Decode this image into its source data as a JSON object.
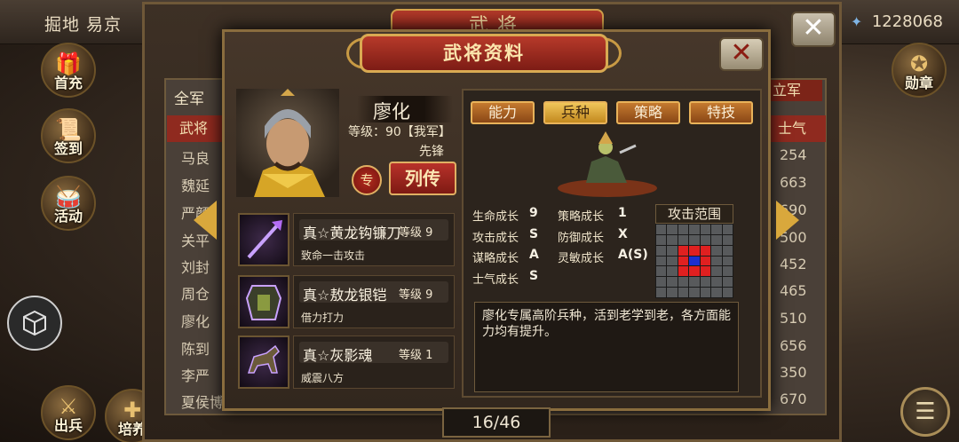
{
  "topbar": {
    "location": "掘地 易京",
    "gold": "1228068",
    "gold_icon": "sapphire-icon"
  },
  "side_buttons": [
    {
      "label": "首充",
      "icon": "gift-icon"
    },
    {
      "label": "签到",
      "icon": "scroll-icon"
    },
    {
      "label": "活动",
      "icon": "drum-icon"
    },
    {
      "label": "出兵",
      "icon": "sword-icon"
    },
    {
      "label": "培养",
      "icon": "training-icon"
    },
    {
      "label": "勋章",
      "icon": "medal-icon"
    }
  ],
  "list_window": {
    "title": "武将",
    "header_left": "全军",
    "header_right": "立军",
    "col_general": "武将",
    "col_morale": "士气",
    "generals": [
      "马良",
      "魏延",
      "严颜",
      "关平",
      "刘封",
      "周仓",
      "廖化",
      "陈到",
      "李严",
      "夏侯博"
    ],
    "morale": [
      "254",
      "663",
      "690",
      "500",
      "452",
      "465",
      "510",
      "656",
      "350",
      "670"
    ],
    "page": "16/46"
  },
  "dialog": {
    "title": "武将资料",
    "name": "廖化",
    "level_text": "等级：90【我军】",
    "role": "先锋",
    "special_badge": "专",
    "bio_button": "列传",
    "equipment": [
      {
        "name": "真☆黄龙钩镰刀",
        "level": "等级 9",
        "desc": "致命一击攻击",
        "icon": "halberd-icon"
      },
      {
        "name": "真☆敖龙银铠",
        "level": "等级 9",
        "desc": "借力打力",
        "icon": "armor-icon"
      },
      {
        "name": "真☆灰影魂",
        "level": "等级 1",
        "desc": "威震八方",
        "icon": "horse-icon"
      }
    ],
    "tabs": [
      "能力",
      "兵种",
      "策略",
      "特技"
    ],
    "active_tab": "兵种",
    "stats": [
      {
        "label": "生命成长",
        "value": "9"
      },
      {
        "label": "攻击成长",
        "value": "S"
      },
      {
        "label": "谋略成长",
        "value": "A"
      },
      {
        "label": "士气成长",
        "value": "S"
      },
      {
        "label": "策略成长",
        "value": "1"
      },
      {
        "label": "防御成长",
        "value": "X"
      },
      {
        "label": "灵敏成长",
        "value": "A(S)"
      }
    ],
    "range_title": "攻击范围",
    "description": "廖化专属高阶兵种，活到老学到老，各方面能力均有提升。"
  },
  "colors": {
    "accent_red": "#a8281c",
    "gold_border": "#d9aa52",
    "tab_active": "#f0c65a",
    "range_center": "#1c2fd0",
    "range_ring": "#e02020"
  }
}
